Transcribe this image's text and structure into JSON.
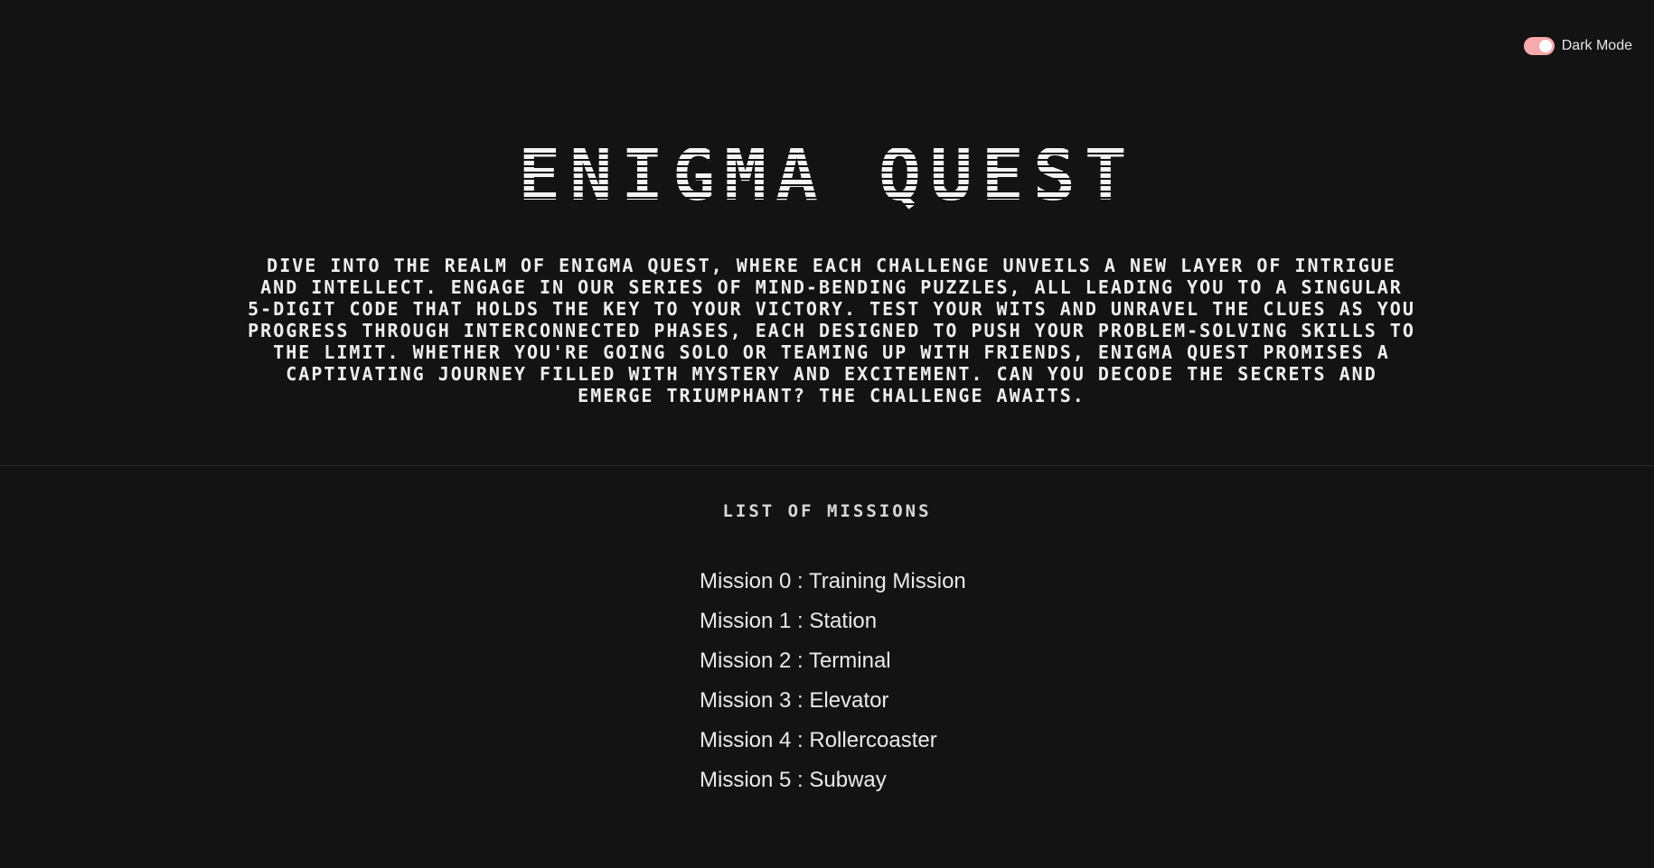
{
  "toggle": {
    "label": "Dark Mode",
    "state": "on",
    "accent_color": "#f7a9ab"
  },
  "hero": {
    "title": "ENIGMA QUEST",
    "description": "DIVE INTO THE REALM OF ENIGMA QUEST, WHERE EACH CHALLENGE UNVEILS A NEW LAYER OF INTRIGUE AND INTELLECT. ENGAGE IN OUR SERIES OF MIND-BENDING PUZZLES, ALL LEADING YOU TO A SINGULAR 5-DIGIT CODE THAT HOLDS THE KEY TO YOUR VICTORY. TEST YOUR WITS AND UNRAVEL THE CLUES AS YOU PROGRESS THROUGH INTERCONNECTED PHASES, EACH DESIGNED TO PUSH YOUR PROBLEM-SOLVING SKILLS TO THE LIMIT. WHETHER YOU'RE GOING SOLO OR TEAMING UP WITH FRIENDS, ENIGMA QUEST PROMISES A CAPTIVATING JOURNEY FILLED WITH MYSTERY AND EXCITEMENT. CAN YOU DECODE THE SECRETS AND EMERGE TRIUMPHANT? THE CHALLENGE AWAITS."
  },
  "missions": {
    "heading": "LIST OF MISSIONS",
    "items": [
      {
        "label": "Mission 0 : Training Mission"
      },
      {
        "label": "Mission 1 : Station"
      },
      {
        "label": "Mission 2 : Terminal"
      },
      {
        "label": "Mission 3 : Elevator"
      },
      {
        "label": "Mission 4 : Rollercoaster"
      },
      {
        "label": "Mission 5 : Subway"
      }
    ]
  },
  "colors": {
    "background": "#131313",
    "text": "#f0f0f0"
  }
}
